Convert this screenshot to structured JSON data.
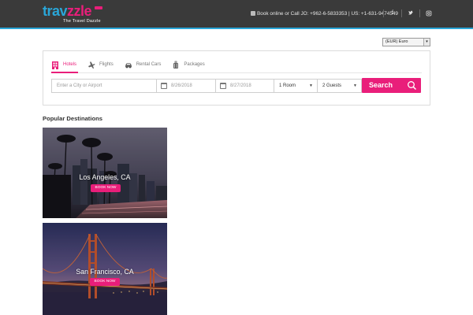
{
  "header": {
    "logo_main": "trav",
    "logo_accent": "zzle",
    "logo_tagline": "The Travel Dazzle",
    "contact_text": "Book online or Call JO: +962-6-5833353 | US: +1-631-9474549",
    "social": [
      "facebook-icon",
      "twitter-icon",
      "instagram-icon"
    ],
    "social_glyphs": [
      "f",
      "t",
      "◎"
    ]
  },
  "currency": {
    "selected": "(EUR) Euro"
  },
  "search": {
    "tabs": [
      {
        "label": "Hotels",
        "icon": "hotel-icon",
        "active": true
      },
      {
        "label": "Flights",
        "icon": "plane-icon",
        "active": false
      },
      {
        "label": "Rental Cars",
        "icon": "car-icon",
        "active": false
      },
      {
        "label": "Packages",
        "icon": "luggage-icon",
        "active": false
      }
    ],
    "city_placeholder": "Enter a City or Airport",
    "check_in": "8/26/2018",
    "check_out": "8/27/2018",
    "rooms": "1 Room",
    "guests": "2 Guests",
    "button_label": "Search"
  },
  "destinations": {
    "title": "Popular Destinations",
    "items": [
      {
        "city": "Los Angeles, CA",
        "cta": "BOOK NOW"
      },
      {
        "city": "San Francisco, CA",
        "cta": "BOOK NOW"
      }
    ]
  },
  "colors": {
    "accent": "#e91e7a",
    "brand_blue": "#2aa6d8",
    "header_bg": "#3a3a3a"
  }
}
